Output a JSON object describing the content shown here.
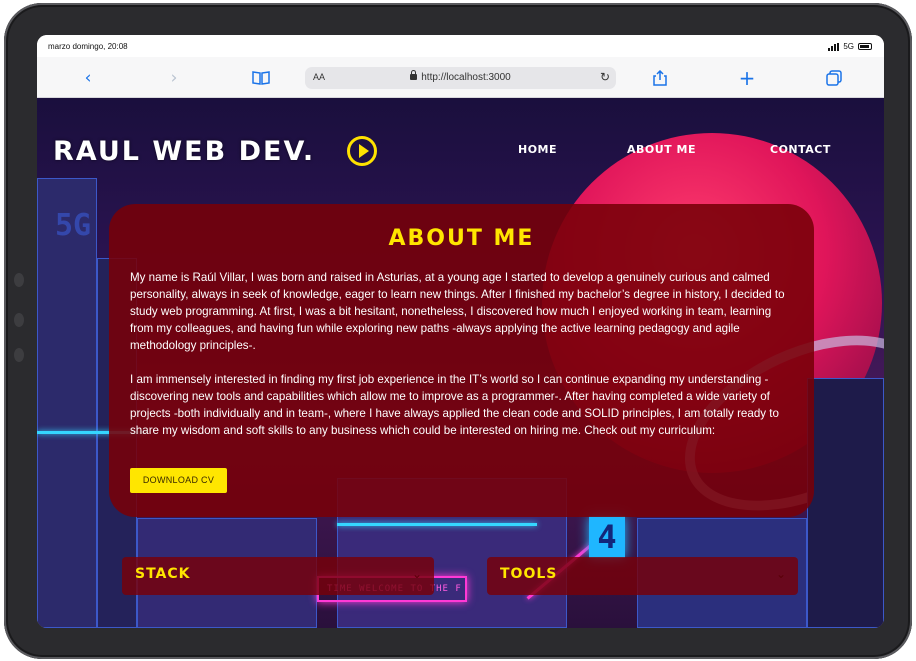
{
  "status": {
    "time": "marzo domingo, 20:08",
    "network": "5G"
  },
  "browser": {
    "reader_label": "AA",
    "url": "http://localhost:3000"
  },
  "site": {
    "logo": "RAUL WEB DEV.",
    "nav": [
      {
        "label": "HOME"
      },
      {
        "label": "ABOUT ME"
      },
      {
        "label": "CONTACT"
      }
    ]
  },
  "background": {
    "sign_5g": "5G",
    "neon_number": "4",
    "neon_sign": "TIME  WELCOME TO THE F"
  },
  "about": {
    "title": "ABOUT ME",
    "paragraphs": [
      "My name is Raúl Villar, I was born and raised in Asturias, at a young age I started to develop a genuinely curious and calmed personality, always in seek of knowledge, eager to learn new things. After I finished my bachelor’s degree in history, I decided to study web programming. At first, I was a bit hesitant, nonetheless, I discovered how much I enjoyed working in team, learning from my colleagues, and having fun while exploring new paths -always applying the active learning pedagogy and agile methodology principles-.",
      "I am immensely interested in finding my first job experience in the IT’s world so I can continue expanding my understanding -discovering new tools and capabilities which allow me to improve as a programmer-. After having completed a wide variety of projects -both individually and in team-, where I have always applied the clean code and SOLID principles, I am totally ready to share my wisdom and soft skills to any business which could be interested on hiring me. Check out my curriculum:"
    ],
    "cv_button": "DOWNLOAD CV"
  },
  "panels": {
    "stack": "STACK",
    "tools": "TOOLS"
  },
  "colors": {
    "accent_yellow": "#ffe600",
    "card_red": "#780008",
    "browser_blue": "#1a73e8"
  }
}
